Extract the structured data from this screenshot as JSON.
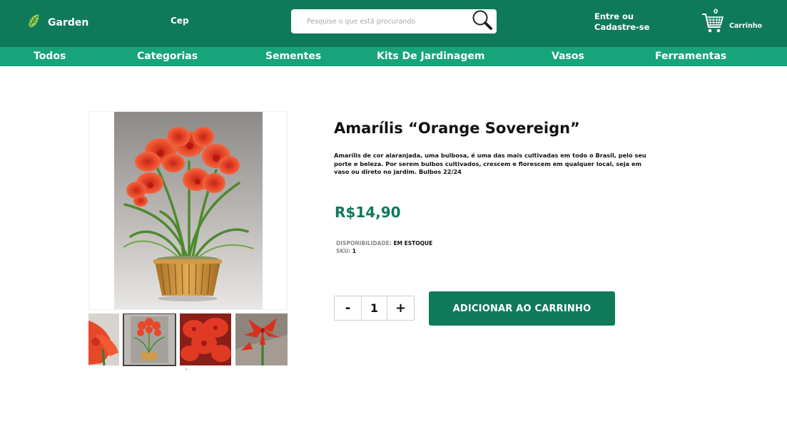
{
  "header": {
    "brand": "Garden",
    "cep_label": "Cep",
    "search_placeholder": "Pesquise o que está procurando",
    "login_line1": "Entre ou",
    "login_line2": "Cadastre-se",
    "cart_count": "0",
    "cart_label": "Carrinho"
  },
  "nav": {
    "items": [
      {
        "label": "Todos"
      },
      {
        "label": "Categorias"
      },
      {
        "label": "Sementes"
      },
      {
        "label": "Kits De Jardinagem"
      },
      {
        "label": "Vasos"
      },
      {
        "label": "Ferramentas"
      }
    ]
  },
  "product": {
    "title": "Amarílis “Orange Sovereign”",
    "description": "Amarílis de cor alaranjada, uma bulbosa, é uma das mais cultivadas em todo o Brasil, pelo seu porte e beleza. Por serem bulbos cultivados, crescem e florescem em qualquer local, seja em vaso ou direto no jardim. Bulbos 22/24",
    "price": "R$14,90",
    "availability_label": "DISPONIBILIDADE:",
    "availability_value": "EM ESTOQUE",
    "sku_label": "SKU:",
    "sku_value": "1",
    "quantity": "1",
    "minus": "-",
    "plus": "+",
    "add_to_cart": "ADICIONAR AO CARRINHO"
  },
  "colors": {
    "brand_dark": "#0f7a5a",
    "brand_light": "#17a47a",
    "flower": "#e8482a"
  }
}
